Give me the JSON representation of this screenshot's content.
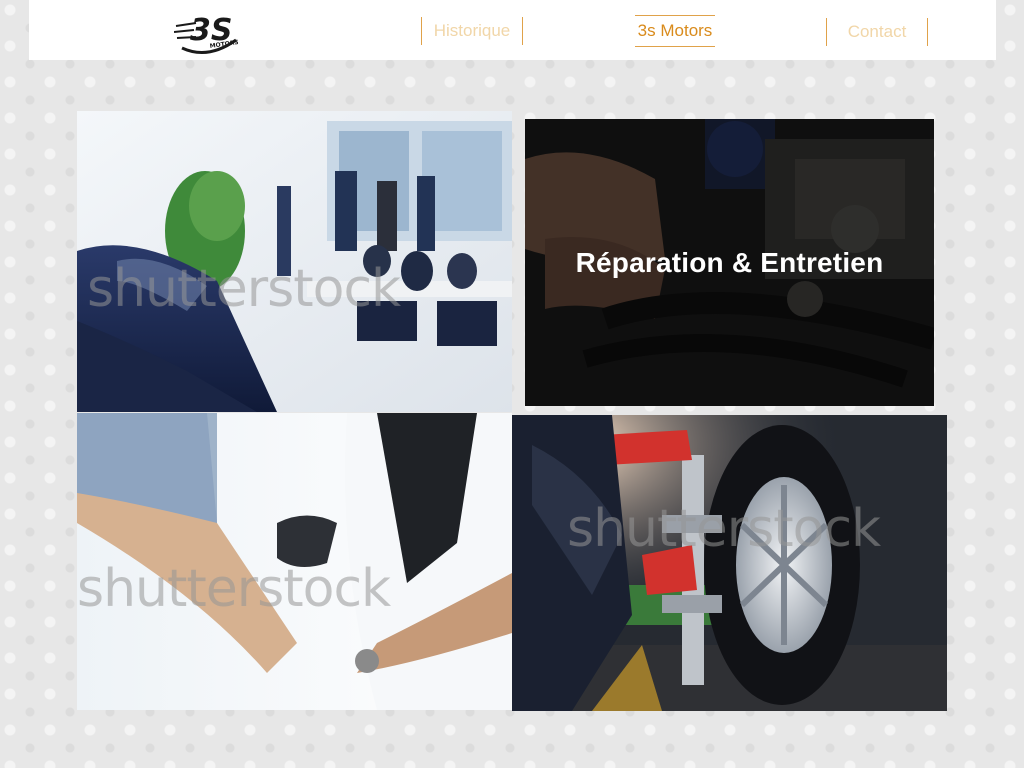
{
  "header": {
    "logo": {
      "text": "3S",
      "subtext": "MOTORS"
    },
    "nav": [
      {
        "label": "Historique"
      },
      {
        "label": "3s Motors"
      },
      {
        "label": "Contact"
      }
    ]
  },
  "tiles": [
    {
      "watermark": "shutterstock",
      "caption": ""
    },
    {
      "watermark": "",
      "caption": "Réparation & Entretien"
    },
    {
      "watermark": "shutterstock",
      "caption": ""
    },
    {
      "watermark": "shutterstock",
      "caption": ""
    }
  ],
  "colors": {
    "accent": "#d98b1c",
    "nav_inactive": "#f1d6a8",
    "background": "#e7e7e7"
  }
}
